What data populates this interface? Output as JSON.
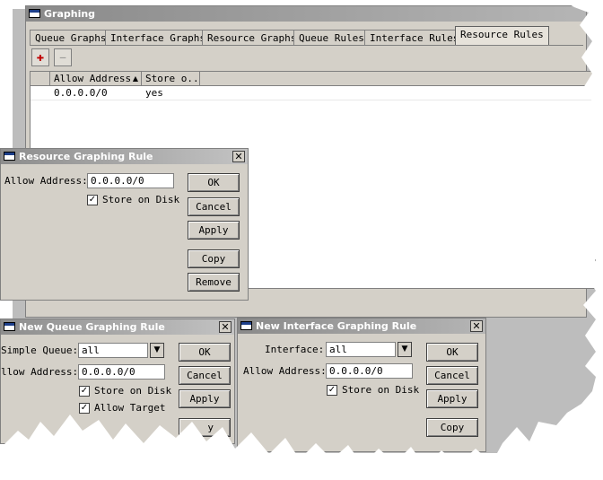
{
  "main_window": {
    "title": "Graphing",
    "tabs": [
      "Queue Graphs",
      "Interface Graphs",
      "Resource Graphs",
      "Queue Rules",
      "Interface Rules",
      "Resource Rules"
    ],
    "active_tab": "Resource Rules",
    "toolbar": {
      "add_symbol": "✚",
      "remove_symbol": "—"
    },
    "table": {
      "headers": [
        "Allow Address",
        "Store o..."
      ],
      "rows": [
        {
          "allow_address": "0.0.0.0/0",
          "store": "yes"
        }
      ]
    }
  },
  "resource_dialog": {
    "title": "Resource Graphing Rule",
    "close_symbol": "✕",
    "allow_address_label": "Allow Address:",
    "allow_address_value": "0.0.0.0/0",
    "store_on_disk_label": "Store on Disk",
    "store_on_disk_checked": "✓",
    "buttons": {
      "ok": "OK",
      "cancel": "Cancel",
      "apply": "Apply",
      "copy": "Copy",
      "remove": "Remove"
    }
  },
  "queue_dialog": {
    "title": "New Queue Graphing Rule",
    "close_symbol": "✕",
    "simple_queue_label": "Simple Queue:",
    "simple_queue_value": "all",
    "allow_address_label": "llow Address:",
    "allow_address_value": "0.0.0.0/0",
    "store_on_disk_label": "Store on Disk",
    "allow_target_label": "Allow Target",
    "check_mark": "✓",
    "dropdown_symbol": "▼",
    "buttons": {
      "ok": "OK",
      "cancel": "Cancel",
      "apply": "Apply",
      "copy_partial": "y"
    }
  },
  "interface_dialog": {
    "title": "New Interface Graphing Rule",
    "close_symbol": "✕",
    "interface_label": "Interface:",
    "interface_value": "all",
    "allow_address_label": "Allow Address:",
    "allow_address_value": "0.0.0.0/0",
    "store_on_disk_label": "Store on Disk",
    "check_mark": "✓",
    "dropdown_symbol": "▼",
    "buttons": {
      "ok": "OK",
      "cancel": "Cancel",
      "apply": "Apply",
      "copy": "Copy"
    }
  }
}
